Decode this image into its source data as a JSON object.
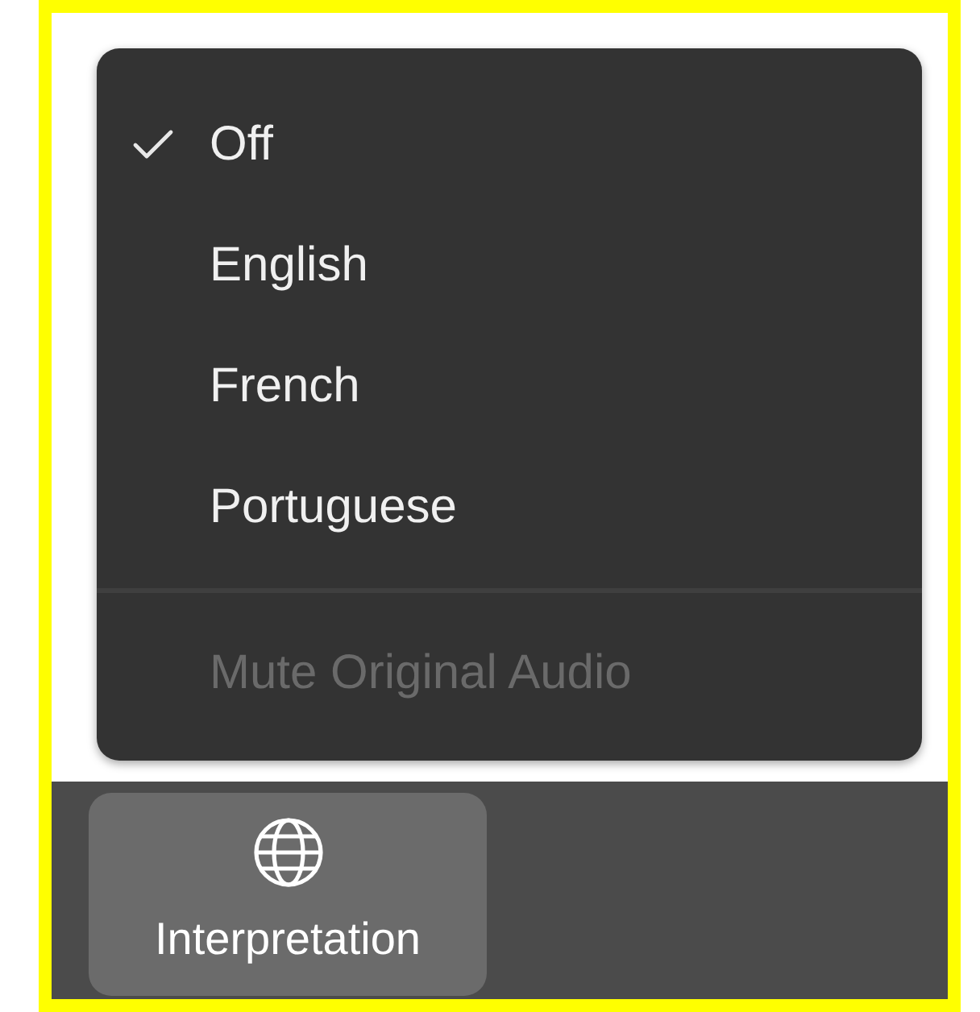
{
  "menu": {
    "items": [
      {
        "label": "Off",
        "selected": true
      },
      {
        "label": "English",
        "selected": false
      },
      {
        "label": "French",
        "selected": false
      },
      {
        "label": "Portuguese",
        "selected": false
      }
    ],
    "actions": [
      {
        "label": "Mute Original Audio",
        "disabled": true
      }
    ]
  },
  "toolbar": {
    "buttons": [
      {
        "label": "Interpretation",
        "kind": "globe"
      }
    ]
  }
}
